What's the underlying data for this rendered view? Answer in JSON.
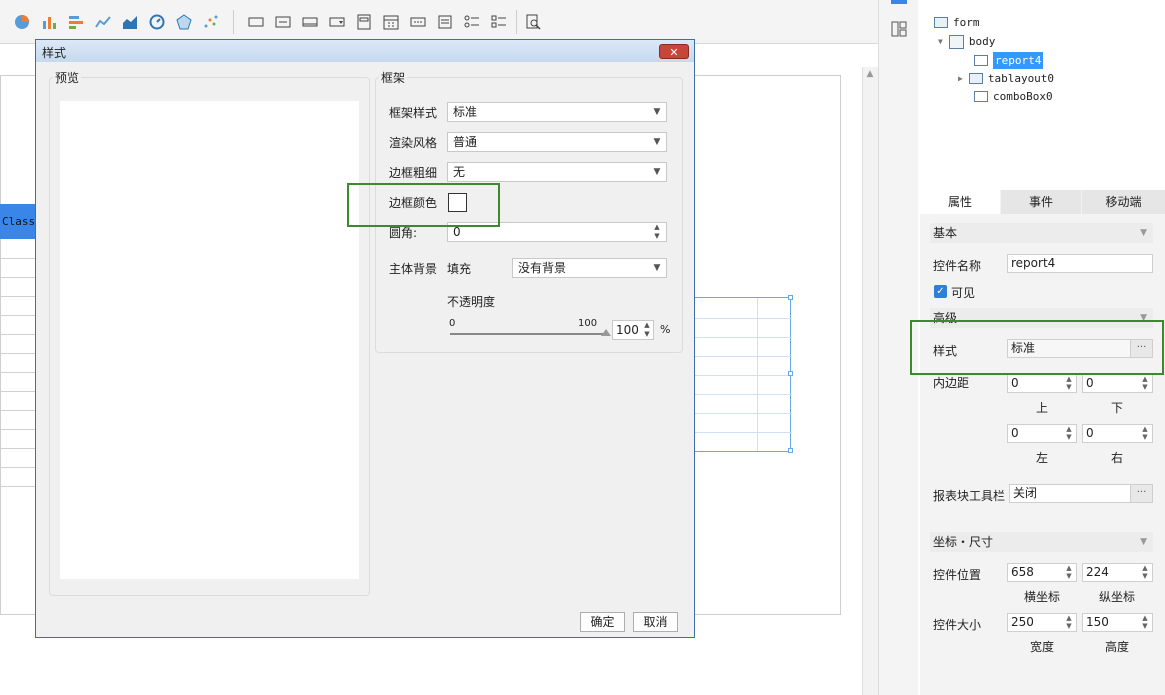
{
  "canvas": {
    "class_header_text": "Class"
  },
  "dialog": {
    "title": "样式",
    "close_glyph": "✕",
    "preview_group_title": "预览",
    "frame_group_title": "框架",
    "fields": {
      "frame_style_label": "框架样式",
      "frame_style_value": "标准",
      "render_style_label": "渲染风格",
      "render_style_value": "普通",
      "border_width_label": "边框粗细",
      "border_width_value": "无",
      "border_color_label": "边框颜色",
      "corner_label": "圆角:",
      "corner_value": "0",
      "body_bg_label": "主体背景",
      "fill_label": "填充",
      "bg_value": "没有背景",
      "opacity_label": "不透明度",
      "slider_min": "0",
      "slider_max": "100",
      "opacity_value": "100",
      "percent": "%"
    },
    "opacity_level": 1.0,
    "ok_label": "确定",
    "cancel_label": "取消"
  },
  "tree": {
    "items": [
      {
        "label": "form"
      },
      {
        "label": "body"
      },
      {
        "label": "report4"
      },
      {
        "label": "tablayout0"
      },
      {
        "label": "comboBox0"
      }
    ]
  },
  "panel": {
    "tabs": [
      {
        "label": "属性"
      },
      {
        "label": "事件"
      },
      {
        "label": "移动端"
      }
    ],
    "basic_section": "基本",
    "name_label": "控件名称",
    "name_value": "report4",
    "visible_label": "可见",
    "visible_checked": true,
    "advanced_section": "高级",
    "style_label": "样式",
    "style_value": "标准",
    "padding_label": "内边距",
    "padding": {
      "top": "0",
      "bottom": "0",
      "left": "0",
      "right": "0"
    },
    "padding_captions": {
      "top": "上",
      "bottom": "下",
      "left": "左",
      "right": "右"
    },
    "toolbar_label": "报表块工具栏",
    "toolbar_value": "关闭",
    "coords_section": "坐标・尺寸",
    "position_label": "控件位置",
    "pos_x": "658",
    "pos_y": "224",
    "pos_x_caption": "横坐标",
    "pos_y_caption": "纵坐标",
    "size_label": "控件大小",
    "width": "250",
    "height": "150",
    "width_caption": "宽度",
    "height_caption": "高度",
    "dots": "···"
  },
  "colors": {
    "accent_blue": "#3a86e8",
    "highlight_green": "#3c8a2e",
    "tree_selected": "#3399ff"
  }
}
